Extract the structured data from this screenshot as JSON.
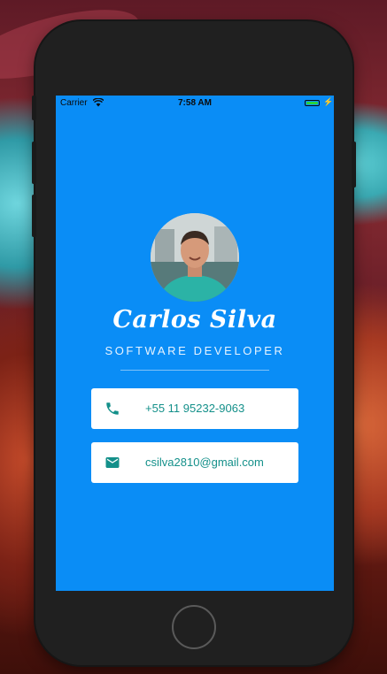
{
  "status_bar": {
    "carrier": "Carrier",
    "time": "7:58 AM",
    "wifi_icon": "wifi-icon",
    "battery_icon": "battery-icon",
    "charging_icon": "charging-bolt-icon"
  },
  "profile": {
    "name": "Carlos Silva",
    "role": "SOFTWARE DEVELOPER"
  },
  "contacts": [
    {
      "icon": "phone-icon",
      "value": "+55 11 95232-9063"
    },
    {
      "icon": "email-icon",
      "value": "csilva2810@gmail.com"
    }
  ],
  "colors": {
    "screen_background": "#0a8df6",
    "contact_text": "#14908a",
    "card_background": "#ffffff",
    "battery": "#27d43f"
  }
}
